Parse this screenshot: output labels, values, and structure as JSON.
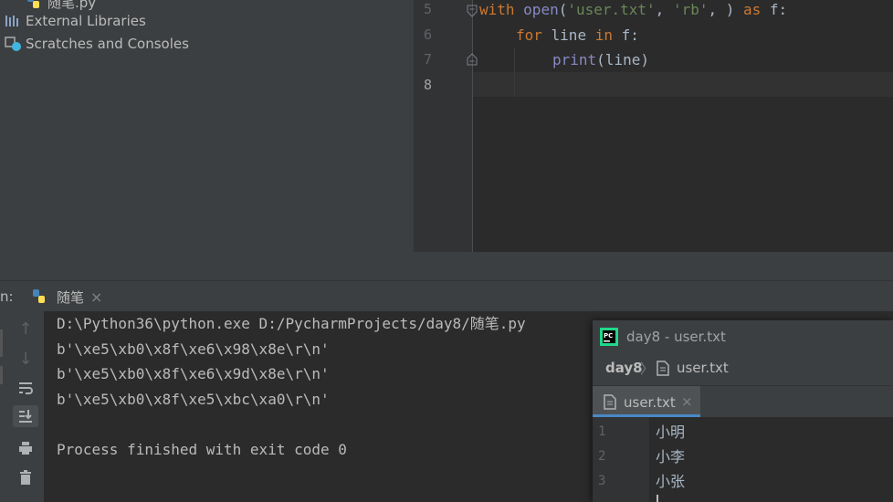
{
  "project": {
    "items": [
      {
        "label": "随笔.py"
      },
      {
        "label": "External Libraries"
      },
      {
        "label": "Scratches and Consoles"
      }
    ]
  },
  "editor": {
    "line_numbers": [
      "5",
      "6",
      "7",
      "8"
    ],
    "line5": {
      "kw_with": "with",
      "open": "open",
      "p1": "(",
      "s1": "'user.txt'",
      "c1": ", ",
      "s2": "'rb'",
      "c2": ", ) ",
      "kw_as": "as",
      "rest": " f:"
    },
    "line6": {
      "kw_for": "for",
      "mid": " line ",
      "kw_in": "in",
      "rest": " f:"
    },
    "line7": {
      "print": "print",
      "rest": "(line)"
    }
  },
  "run": {
    "prefix": "n:",
    "tab_label": "随笔",
    "close": "×"
  },
  "console": {
    "lines": [
      "D:\\Python36\\python.exe D:/PycharmProjects/day8/随笔.py",
      "b'\\xe5\\xb0\\x8f\\xe6\\x98\\x8e\\r\\n'",
      "b'\\xe5\\xb0\\x8f\\xe6\\x9d\\x8e\\r\\n'",
      "b'\\xe5\\xb0\\x8f\\xe5\\xbc\\xa0\\r\\n'",
      "Process finished with exit code 0"
    ]
  },
  "popup": {
    "title": "day8 - user.txt",
    "breadcrumb_project": "day8",
    "breadcrumb_sep": "〉",
    "breadcrumb_file": "user.txt",
    "tab_label": "user.txt",
    "tab_close": "×",
    "line_numbers": [
      "1",
      "2",
      "3"
    ],
    "lines": [
      "小明",
      "小李",
      "小张"
    ]
  },
  "colors": {
    "keyword": "#cc7832",
    "string": "#6a8759",
    "builtin": "#8888c6",
    "text": "#a9b7c6",
    "accent": "#4a88c7"
  }
}
